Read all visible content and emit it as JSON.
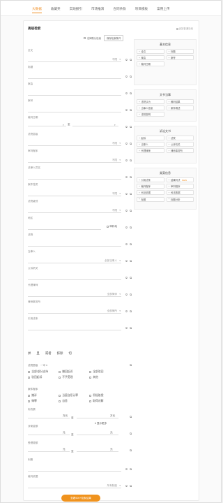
{
  "nav": [
    "大数据",
    "收藏夹",
    "实践报引",
    "市场推演",
    "合同条款",
    "项目模板",
    "案例上传"
  ],
  "card": {
    "title": "高级检索",
    "tip": "返回普通检索"
  },
  "toolbar": {
    "checkbox_label": "法律默认检索",
    "button_label": "保存检索条件"
  },
  "fields": [
    {
      "label": "全文",
      "value": "不限",
      "kind": "select"
    },
    {
      "label": "标题",
      "value": "",
      "kind": "text"
    },
    {
      "label": "案由",
      "value": "",
      "kind": "text"
    },
    {
      "label": "案号",
      "value": "",
      "kind": "text"
    },
    {
      "label": "裁判日期",
      "value": "至",
      "kind": "range"
    },
    {
      "label": "法院层级",
      "value": "不限",
      "kind": "select"
    },
    {
      "label": "审判程序",
      "value": "不限",
      "kind": "select"
    },
    {
      "label": "法律人员名",
      "value": "",
      "kind": "text"
    },
    {
      "label": "案件性质",
      "value": "不限",
      "kind": "select"
    },
    {
      "label": "法院级别",
      "value": "不限",
      "kind": "select"
    },
    {
      "label": "地区",
      "value": "审判地",
      "kind": "check"
    },
    {
      "label": "法院",
      "value": "",
      "kind": "text"
    },
    {
      "label": "当事人",
      "value": "全部当事人",
      "kind": "select"
    },
    {
      "label": "公诉机关",
      "value": "",
      "kind": "text"
    },
    {
      "label": "代理律师",
      "value": "全部律师",
      "kind": "select"
    },
    {
      "label": "律师事务所",
      "value": "全部律所",
      "kind": "select"
    },
    {
      "label": "引用法条",
      "value": "",
      "kind": "text"
    }
  ],
  "logic": [
    "并",
    "且",
    "或者",
    "排除",
    "切"
  ],
  "filters": {
    "level_label": "法院层级",
    "level_value": "一审",
    "result_options": [
      "全部/部分支持",
      "撤回起诉",
      "全部驳回",
      "驳回起诉",
      "不予受理",
      "其他"
    ],
    "judge_label": "案件程序",
    "judge_options": [
      "撤诉",
      "当庭自愿认罪",
      "积极赔偿",
      "悔罪",
      "自首",
      "取得谅解"
    ]
  },
  "show_more": "显示更多",
  "extra_fields": [
    {
      "label": "标的额",
      "from": "万元",
      "sep": "至",
      "to": "万元"
    },
    {
      "label": "涉案金额",
      "from": "元",
      "sep": "至",
      "to": "元"
    },
    {
      "label": "受理费额",
      "from": "元",
      "sep": "至",
      "to": "元"
    },
    {
      "label": "刑期",
      "value": ""
    },
    {
      "label": "裁判依据",
      "value": "所有制度"
    }
  ],
  "submit": "查看500+检索结果",
  "panels": [
    {
      "title": "基本信息",
      "tags": [
        "全文",
        "标题",
        "案由",
        "案号",
        "裁判日期"
      ]
    },
    {
      "title": "文书当事",
      "tags": [
        "法院认为",
        "裁判结果",
        "当事人信息",
        "案件概述",
        "法院查明"
      ]
    },
    {
      "title": "诉讼文书",
      "tags": [
        "起诉",
        "法院",
        "当事人",
        "公诉机关",
        "代理律师",
        "律师事务所"
      ]
    },
    {
      "title": "类案信息",
      "tags": [
        "引用法条",
        "结果判决",
        "裁判程序",
        "审判程序",
        "司法依据",
        "司法数据",
        "标题",
        "标题分析"
      ]
    }
  ],
  "hot_badge": "NEW",
  "colors": {
    "accent": "#f08c1e",
    "button": "#f0931e"
  }
}
